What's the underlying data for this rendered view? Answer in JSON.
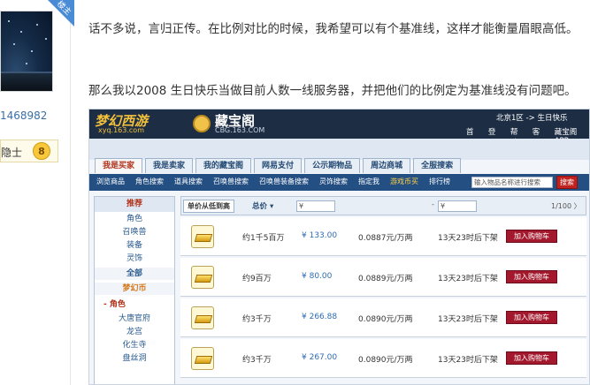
{
  "profile": {
    "corner_badge": "楼主",
    "user_id": "1468982",
    "rank_label": "隐士",
    "rank_level": "8"
  },
  "article": {
    "paragraph1": "话不多说，言归正传。在比例对比的时候，我希望可以有个基准线，这样才能衡量眉眼高低。",
    "paragraph2": "那么我以2008 生日快乐当做目前人数一线服务器，并把他们的比例定为基准线没有问题吧。"
  },
  "screenshot": {
    "logo_text": "梦幻西游",
    "logo_url": "xyq.163.com",
    "site_title": "藏宝阁",
    "site_url": "CBG.163.COM",
    "server": "北京1区 -> 生日快乐",
    "top_links": [
      "首页",
      "登录",
      "帮助",
      "客服",
      "藏宝阁APP"
    ],
    "tabs": [
      "我是买家",
      "我是卖家",
      "我的藏宝阁",
      "网易支付",
      "公示期物品",
      "周边商城",
      "全服搜索"
    ],
    "subnav": [
      "浏览商品",
      "角色搜索",
      "道具搜索",
      "召唤兽搜索",
      "召唤兽装备搜索",
      "灵饰搜索",
      "指定我",
      "游戏币买",
      "排行榜"
    ],
    "subnav_search_placeholder": "输入物品名称进行搜索",
    "subnav_search_button": "搜索",
    "sidebar": [
      {
        "label": "推荐",
        "kind": "head"
      },
      {
        "label": "角色",
        "kind": "item"
      },
      {
        "label": "召唤兽",
        "kind": "item"
      },
      {
        "label": "装备",
        "kind": "item"
      },
      {
        "label": "灵饰",
        "kind": "item"
      },
      {
        "label": "全部",
        "kind": "sub"
      },
      {
        "label": "梦幻币",
        "kind": "orange"
      },
      {
        "label": "- 角色",
        "kind": "cat"
      },
      {
        "label": "大唐官府",
        "kind": "item"
      },
      {
        "label": "龙宫",
        "kind": "item"
      },
      {
        "label": "化生寺",
        "kind": "item"
      },
      {
        "label": "盘丝洞",
        "kind": "item"
      }
    ],
    "sort_label": "单价从低到高",
    "price_label": "总价 ▾",
    "price_from": "¥",
    "price_to": "¥",
    "price_sep": "-",
    "pager": "1/100 〉",
    "listings": [
      {
        "qty": "约1千5百万",
        "price": "¥ 133.00",
        "unit": "0.0887元/万两",
        "time": "13天23时后下架",
        "button": "加入购物车"
      },
      {
        "qty": "约9百万",
        "price": "¥ 80.00",
        "unit": "0.0889元/万两",
        "time": "13天23时后下架",
        "button": "加入购物车"
      },
      {
        "qty": "约3千万",
        "price": "¥ 266.88",
        "unit": "0.0890元/万两",
        "time": "13天23时后下架",
        "button": "加入购物车"
      },
      {
        "qty": "约3千万",
        "price": "¥ 267.00",
        "unit": "0.0890元/万两",
        "time": "13天23时后下架",
        "button": "加入购物车"
      }
    ]
  }
}
